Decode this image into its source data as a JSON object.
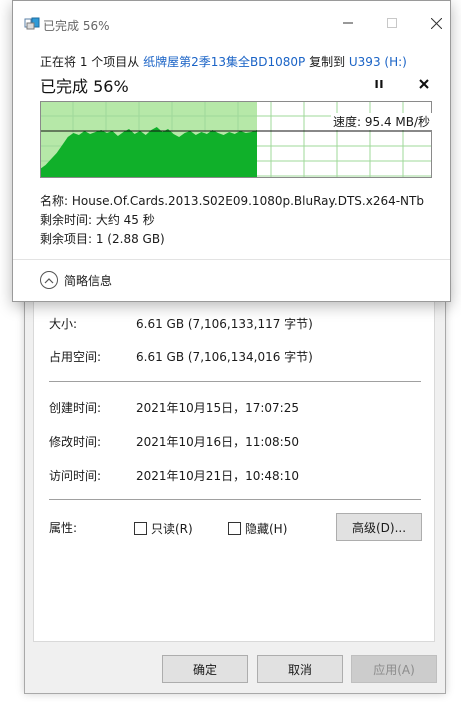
{
  "copy_dialog": {
    "title": "已完成 56%",
    "header": {
      "prefix": "正在将 1 个项目从 ",
      "source": "纸牌屋第2季13集全BD1080P",
      "middle": " 复制到 ",
      "dest": "U393 (H:)"
    },
    "progress_text": "已完成 56%",
    "progress_fraction": 0.56,
    "speed_text": "速度: 95.4 MB/秒",
    "name_line": "名称: House.Of.Cards.2013.S02E09.1080p.BluRay.DTS.x264-NTb",
    "time_line": "剩余时间: 大约 45 秒",
    "items_line": "剩余项目: 1 (2.88 GB)",
    "details_toggle": "简略信息",
    "colors": {
      "fill_dark": "#10b02a",
      "fill_light": "#b6e8a8",
      "grid": "#9fd89a"
    }
  },
  "properties": {
    "size_label": "大小:",
    "size_value": "6.61 GB (7,106,133,117 字节)",
    "disk_label": "占用空间:",
    "disk_value": "6.61 GB (7,106,134,016 字节)",
    "created_label": "创建时间:",
    "created_value": "2021年10月15日，17:07:25",
    "modified_label": "修改时间:",
    "modified_value": "2021年10月16日，11:08:50",
    "accessed_label": "访问时间:",
    "accessed_value": "2021年10月21日，10:48:10",
    "attributes_label": "属性:",
    "readonly_label": "只读(R)",
    "hidden_label": "隐藏(H)",
    "advanced_label": "高级(D)...",
    "ok_label": "确定",
    "cancel_label": "取消",
    "apply_label": "应用(A)"
  }
}
